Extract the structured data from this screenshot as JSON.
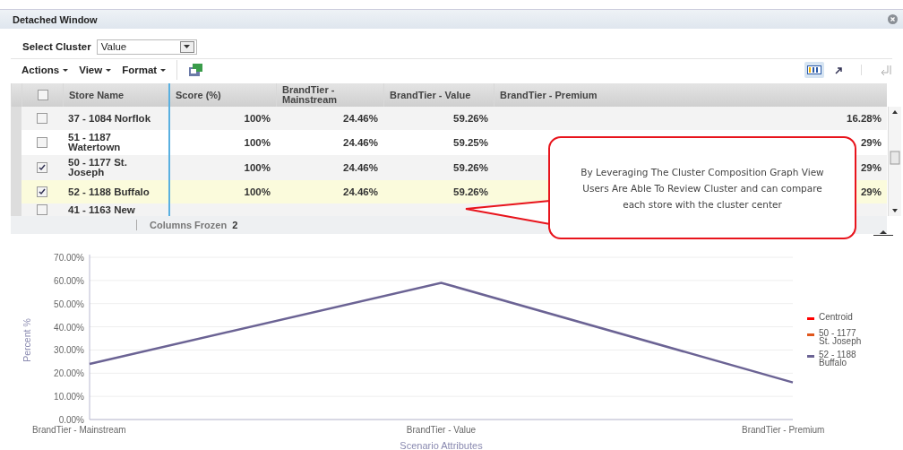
{
  "window": {
    "title": "Detached Window"
  },
  "cluster_select": {
    "label": "Select Cluster",
    "value": "Value"
  },
  "menus": [
    {
      "label": "Actions"
    },
    {
      "label": "View"
    },
    {
      "label": "Format"
    }
  ],
  "toolbar": {
    "column_view_selected": true
  },
  "select_all_checked": false,
  "table": {
    "columns": [
      "Store Name",
      "Score (%)",
      "BrandTier - Mainstream",
      "BrandTier - Value",
      "BrandTier - Premium"
    ],
    "rows": [
      {
        "store": "37 - 1084 Norflok",
        "score": "100%",
        "mainstream": "24.46%",
        "value": "59.26%",
        "premium": "16.28%",
        "checked": false,
        "selected": false
      },
      {
        "store": "51 - 1187 Watertown",
        "score": "100%",
        "mainstream": "24.46%",
        "value": "59.25%",
        "premium": "29%",
        "checked": false,
        "selected": false
      },
      {
        "store": "50 - 1177 St. Joseph",
        "score": "100%",
        "mainstream": "24.46%",
        "value": "59.26%",
        "premium": "29%",
        "checked": true,
        "selected": false
      },
      {
        "store": "52 - 1188 Buffalo",
        "score": "100%",
        "mainstream": "24.46%",
        "value": "59.26%",
        "premium": "29%",
        "checked": true,
        "selected": true
      },
      {
        "store": "41 - 1163 New",
        "checked": false,
        "selected": false
      }
    ],
    "footer": {
      "label": "Columns Frozen",
      "count": "2"
    }
  },
  "callout": {
    "text": "By Leveraging The Cluster Composition Graph View Users Are Able To Review Cluster and can compare each store with the cluster center"
  },
  "chart": {
    "chart_data": {
      "type": "line",
      "xlabel": "Scenario Attributes",
      "ylabel": "Percent %",
      "categories": [
        "BrandTier - Mainstream",
        "BrandTier - Value",
        "BrandTier - Premium"
      ],
      "ylim": [
        0,
        70
      ],
      "grid": true,
      "legend": true,
      "yticks": [
        {
          "value": 0,
          "label": "0.00%"
        },
        {
          "value": 10,
          "label": "10.00%"
        },
        {
          "value": 20,
          "label": "20.00%"
        },
        {
          "value": 30,
          "label": "30.00%"
        },
        {
          "value": 40,
          "label": "40.00%"
        },
        {
          "value": 50,
          "label": "50.00%"
        },
        {
          "value": 60,
          "label": "60.00%"
        },
        {
          "value": 70,
          "label": "70.00%"
        }
      ],
      "series": [
        {
          "name": "Centroid",
          "color": "#ff0000",
          "values": [
            null,
            null,
            null
          ]
        },
        {
          "name": "50 - 1177 St. Joseph",
          "color": "#e0561c",
          "values": [
            null,
            null,
            null
          ]
        },
        {
          "name": "52 - 1188 Buffalo",
          "color": "#6b6394",
          "values": [
            24,
            59,
            16
          ]
        }
      ]
    }
  }
}
